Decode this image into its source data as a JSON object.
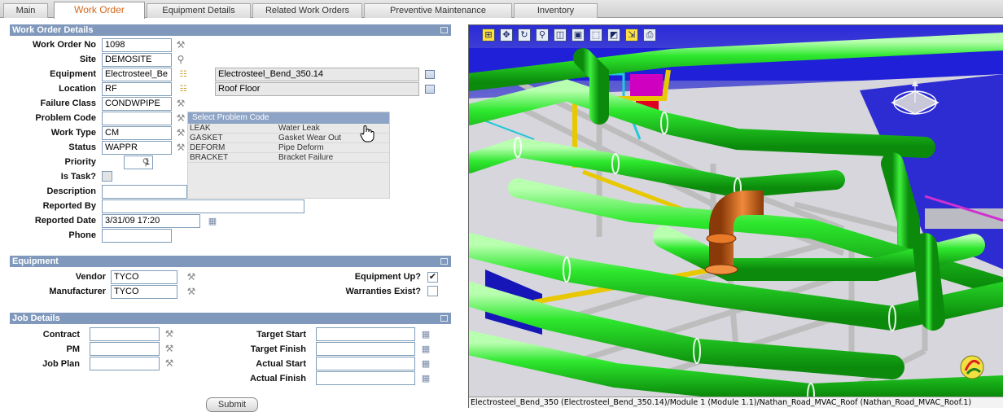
{
  "tabs": [
    {
      "label": "Main",
      "active": false
    },
    {
      "label": "Work Order",
      "active": true
    },
    {
      "label": "Equipment Details",
      "active": false
    },
    {
      "label": "Related Work Orders",
      "active": false
    },
    {
      "label": "Preventive Maintenance",
      "active": false
    },
    {
      "label": "Inventory",
      "active": false
    }
  ],
  "work_order_details": {
    "title": "Work Order Details",
    "work_order_no": {
      "label": "Work Order No",
      "value": "1098"
    },
    "site": {
      "label": "Site",
      "value": "DEMOSITE"
    },
    "equipment": {
      "label": "Equipment",
      "value": "Electrosteel_Be",
      "description": "Electrosteel_Bend_350.14"
    },
    "location": {
      "label": "Location",
      "value": "RF",
      "description": "Roof Floor"
    },
    "failure_class": {
      "label": "Failure Class",
      "value": "CONDWPIPE"
    },
    "problem_code": {
      "label": "Problem Code",
      "value": ""
    },
    "work_type": {
      "label": "Work Type",
      "value": "CM"
    },
    "status": {
      "label": "Status",
      "value": "WAPPR"
    },
    "priority": {
      "label": "Priority",
      "value": "1"
    },
    "is_task": {
      "label": "Is Task?",
      "checked": false
    },
    "description": {
      "label": "Description",
      "value": ""
    },
    "reported_by": {
      "label": "Reported By",
      "value": ""
    },
    "reported_date": {
      "label": "Reported Date",
      "value": "3/31/09 17:20"
    },
    "phone": {
      "label": "Phone",
      "value": ""
    }
  },
  "problem_code_dropdown": {
    "title": "Select Problem Code",
    "options": [
      {
        "code": "LEAK",
        "description": "Water Leak"
      },
      {
        "code": "GASKET",
        "description": "Gasket Wear Out"
      },
      {
        "code": "DEFORM",
        "description": "Pipe Deform"
      },
      {
        "code": "BRACKET",
        "description": "Bracket Failure"
      }
    ]
  },
  "equipment_section": {
    "title": "Equipment",
    "vendor": {
      "label": "Vendor",
      "value": "TYCO"
    },
    "manufacturer": {
      "label": "Manufacturer",
      "value": "TYCO"
    },
    "equipment_up": {
      "label": "Equipment Up?",
      "checked": true
    },
    "warranties_exist": {
      "label": "Warranties Exist?",
      "checked": false
    }
  },
  "job_details": {
    "title": "Job Details",
    "contract": {
      "label": "Contract",
      "value": ""
    },
    "pm": {
      "label": "PM",
      "value": ""
    },
    "job_plan": {
      "label": "Job Plan",
      "value": ""
    },
    "target_start": {
      "label": "Target Start",
      "value": ""
    },
    "target_finish": {
      "label": "Target Finish",
      "value": ""
    },
    "actual_start": {
      "label": "Actual Start",
      "value": ""
    },
    "actual_finish": {
      "label": "Actual Finish",
      "value": ""
    }
  },
  "submit_label": "Submit",
  "viewer": {
    "toolbar_icons": [
      "fit-all-icon",
      "pan-icon",
      "rotate-icon",
      "zoom-icon",
      "view-cube-icon",
      "shading-icon",
      "select-icon",
      "section-icon",
      "measure-icon",
      "print-icon"
    ],
    "status_text": "Electrosteel_Bend_350 (Electrosteel_Bend_350.14)/Module 1 (Module 1.1)/Nathan_Road_MVAC_Roof (Nathan_Road_MVAC_Roof.1)",
    "colors": {
      "pipe": "#22dd22",
      "highlight_bend": "#e07020",
      "structure": "#c8c8c8",
      "floor": "#d9d9d9",
      "duct": "#0000c8"
    }
  }
}
